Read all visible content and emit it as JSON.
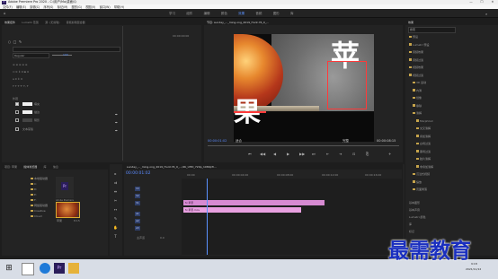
{
  "app": {
    "title": "Adobe Premiere Pro 2020 - C:\\用户\\Ma\\桌面\\Q",
    "logo_text": "Pr",
    "window_controls": [
      "—",
      "☐",
      "✕"
    ]
  },
  "menu": [
    "文件(F)",
    "编辑(E)",
    "剪辑(C)",
    "序列(S)",
    "标记(M)",
    "图形(G)",
    "视图(V)",
    "窗口(W)",
    "帮助(H)"
  ],
  "workspaces": {
    "tabs": [
      "学习",
      "组件",
      "编辑",
      "颜色",
      "效果",
      "音频",
      "图形",
      "库"
    ],
    "active_index": 4
  },
  "left_panel": {
    "tabs": [
      "效果控件",
      "Lumetri 范围",
      "源: (无剪辑)",
      "音频剪辑混合器"
    ],
    "active_tab": 0,
    "font_value": "Regular",
    "size_value": "100",
    "section_label": "外观",
    "stroke_label": "描边",
    "shadow_label": "阴影",
    "text_mask_label": "文本蒙版",
    "fill_label": "填充",
    "timecode": "00:00:00:00"
  },
  "program_monitor": {
    "tab": "节目: sunday_..._ming.ong_2019_Hunt.Y6_0_...",
    "canvas_chars": [
      "苹",
      "果"
    ],
    "timecode_left": "00:00:01:02",
    "fit_label": "适合",
    "quality_label": "完整",
    "timecode_right": "00:00:08:15",
    "controls": [
      "⏮",
      "◀◀",
      "◀",
      "▶",
      "▶▶",
      "⏭",
      "⇤",
      "⇥",
      "⊡",
      "⎘",
      "+"
    ]
  },
  "project_panel": {
    "tabs": [
      "项目: 苹果",
      "媒体浏览器",
      "库",
      "信息"
    ],
    "thumbnail_label": "Adobe Premiere",
    "clip_label": "苹果",
    "clip_duration": "8:15",
    "folders": [
      "本地驱动器",
      "C:",
      "D:",
      "E:",
      "F:",
      "网络驱动器",
      "Creative",
      "Cloud"
    ]
  },
  "timeline": {
    "tab": "sunday_..._ming.ong_2019_Hunt.Y6_0_.../4K_UHD_720p_1080pTi...",
    "timecode": "00:00:01:02",
    "tracks": [
      "V3",
      "V2",
      "V1",
      "A1",
      "A2",
      "A3",
      "主声道"
    ],
    "master_value": "0.0",
    "clips": [
      {
        "track": "V2",
        "label": "fx 苹果"
      },
      {
        "track": "V1",
        "label": "fx 苹果.mov"
      }
    ],
    "ruler": [
      "00:00",
      "00:00:04:00",
      "00:00:08:00",
      "00:00:12:00",
      "00:00:16:00"
    ]
  },
  "effects_panel": {
    "tab": "效果",
    "search_placeholder": "搜索",
    "items": [
      "预设",
      "Lumetri 预设",
      "音频效果",
      "音频过渡",
      "视频效果",
      "视频过渡",
      "3D 运动",
      "内滑",
      "划像",
      "擦除",
      "溶解",
      "MorphCut",
      "交叉溶解",
      "叠加溶解",
      "白场过渡",
      "黑场过渡",
      "胶片溶解",
      "非叠加溶解",
      "沉浸式视频",
      "缩放",
      "页面剥落",
      "基本图形",
      "基本声音",
      "Lumetri 颜色",
      "库",
      "标记",
      "历史记录",
      "信息",
      "工具",
      "项目",
      "基本",
      "效果控件"
    ],
    "bottom_items": [
      "基本图形",
      "基本声音",
      "Lumetri 颜色",
      "库",
      "标记"
    ]
  },
  "taskbar": {
    "time": "9:18",
    "date": "2021/11/12"
  },
  "watermark": "最需教育",
  "colors": {
    "accent": "#5b93ff",
    "clip_pink": "#d78ad2",
    "audio_pink": "#e8a0e0",
    "watermark": "#1a2fbf"
  }
}
